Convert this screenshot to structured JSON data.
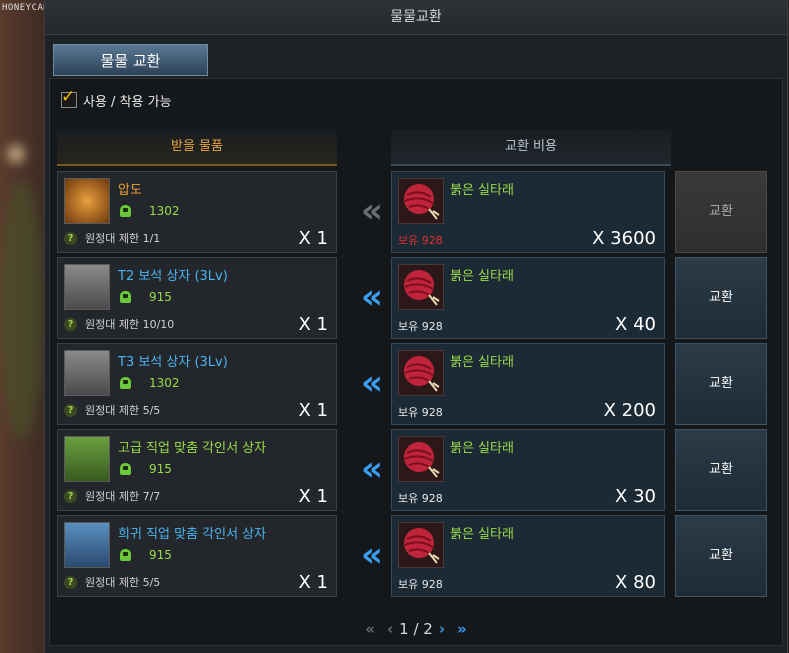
{
  "watermark": "HONEYCAM",
  "window": {
    "title": "물물교환"
  },
  "tab": {
    "label": "물물 교환"
  },
  "filter": {
    "label": "사용 / 착용 가능",
    "checked": true
  },
  "columns": {
    "receive": "받을 물품",
    "cost": "교환 비용"
  },
  "rows": [
    {
      "name": "압도",
      "name_color": "#f0a030",
      "level": "1302",
      "limit": "원정대 제한 1/1",
      "qty": "X 1",
      "cost_name": "붉은 실타래",
      "hold": "보유 928",
      "hold_color": "#e03030",
      "cost_qty": "X 3600",
      "button": "교환",
      "enabled": false,
      "icon": "rune-icon"
    },
    {
      "name": "T2 보석 상자 (3Lv)",
      "name_color": "#4ab4f0",
      "level": "915",
      "limit": "원정대 제한 10/10",
      "qty": "X 1",
      "cost_name": "붉은 실타래",
      "hold": "보유 928",
      "hold_color": "#e8e8e8",
      "cost_qty": "X 40",
      "button": "교환",
      "enabled": true,
      "icon": "chest-icon"
    },
    {
      "name": "T3 보석 상자 (3Lv)",
      "name_color": "#4ab4f0",
      "level": "1302",
      "limit": "원정대 제한 5/5",
      "qty": "X 1",
      "cost_name": "붉은 실타래",
      "hold": "보유 928",
      "hold_color": "#e8e8e8",
      "cost_qty": "X 200",
      "button": "교환",
      "enabled": true,
      "icon": "chest-icon"
    },
    {
      "name": "고급 직업 맞춤 각인서 상자",
      "name_color": "#9adb4a",
      "level": "915",
      "limit": "원정대 제한 7/7",
      "qty": "X 1",
      "cost_name": "붉은 실타래",
      "hold": "보유 928",
      "hold_color": "#e8e8e8",
      "cost_qty": "X 30",
      "button": "교환",
      "enabled": true,
      "icon": "green-chest-icon"
    },
    {
      "name": "희귀 직업 맞춤 각인서 상자",
      "name_color": "#4ab4f0",
      "level": "915",
      "limit": "원정대 제한 5/5",
      "qty": "X 1",
      "cost_name": "붉은 실타래",
      "hold": "보유 928",
      "hold_color": "#e8e8e8",
      "cost_qty": "X 80",
      "button": "교환",
      "enabled": true,
      "icon": "blue-chest-icon"
    }
  ],
  "pager": {
    "text": "1 / 2"
  },
  "colors": {
    "accent_gold": "#e6a640",
    "arrow_active": "#3a9ef0",
    "arrow_inactive": "#6a6f75"
  }
}
